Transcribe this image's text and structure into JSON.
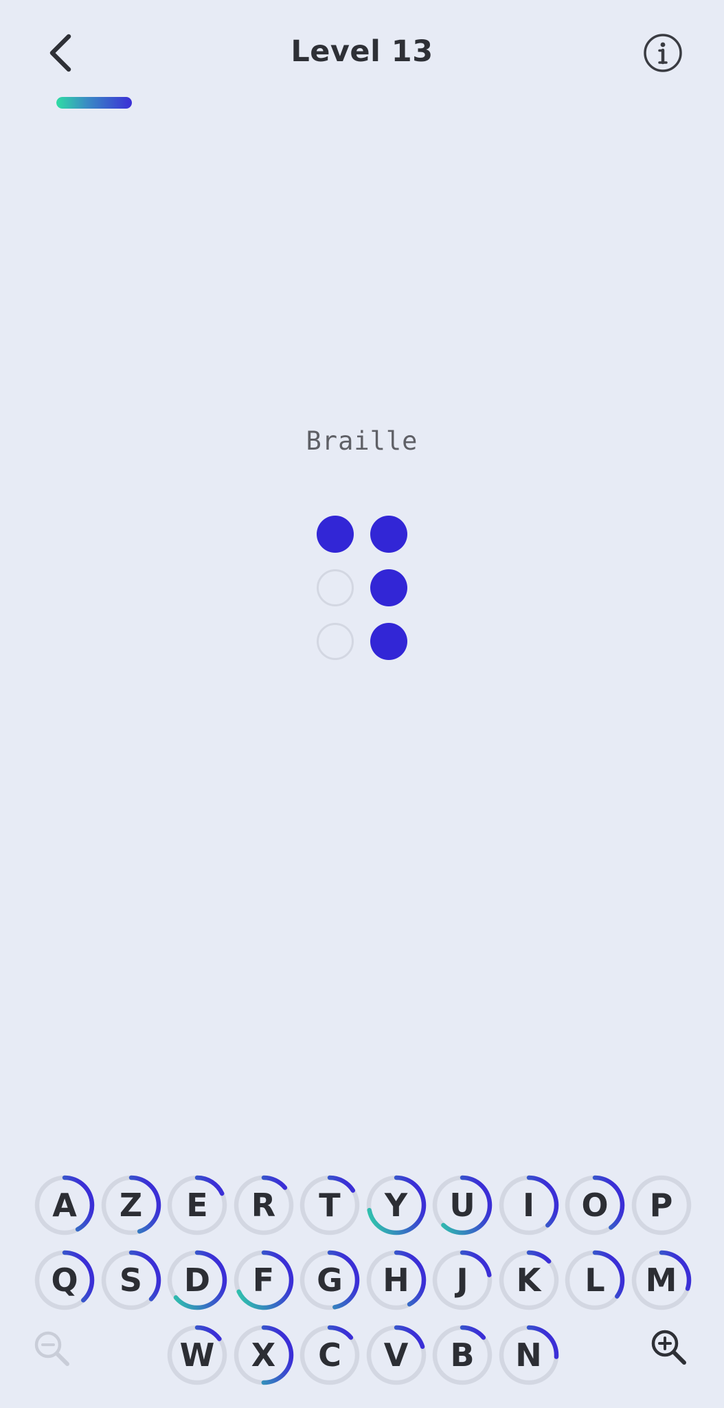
{
  "header": {
    "title": "Level 13",
    "back_icon": "chevron-left-icon",
    "info_icon": "info-icon"
  },
  "progress": {
    "fraction": 0.33
  },
  "cipher": {
    "label": "Braille",
    "dots": [
      true,
      false,
      false,
      true,
      true,
      true
    ]
  },
  "colors": {
    "background": "#e7ebf5",
    "dot_filled": "#3226d6",
    "dot_empty_border": "#d3d7e2",
    "ring_track": "#d3d7e2",
    "ring_start": "#2fd3a8",
    "ring_end": "#3b2fd6"
  },
  "keyboard": {
    "rows": [
      [
        {
          "letter": "A",
          "progress": 0.42
        },
        {
          "letter": "Z",
          "progress": 0.45
        },
        {
          "letter": "E",
          "progress": 0.18
        },
        {
          "letter": "R",
          "progress": 0.14
        },
        {
          "letter": "T",
          "progress": 0.16
        },
        {
          "letter": "Y",
          "progress": 0.72
        },
        {
          "letter": "U",
          "progress": 0.62
        },
        {
          "letter": "I",
          "progress": 0.38
        },
        {
          "letter": "O",
          "progress": 0.4
        },
        {
          "letter": "P",
          "progress": 0.0
        }
      ],
      [
        {
          "letter": "Q",
          "progress": 0.38
        },
        {
          "letter": "S",
          "progress": 0.37
        },
        {
          "letter": "D",
          "progress": 0.64
        },
        {
          "letter": "F",
          "progress": 0.68
        },
        {
          "letter": "G",
          "progress": 0.47
        },
        {
          "letter": "H",
          "progress": 0.42
        },
        {
          "letter": "J",
          "progress": 0.22
        },
        {
          "letter": "K",
          "progress": 0.13
        },
        {
          "letter": "L",
          "progress": 0.35
        },
        {
          "letter": "M",
          "progress": 0.3
        }
      ],
      [
        {
          "letter": "W",
          "progress": 0.15
        },
        {
          "letter": "X",
          "progress": 0.5
        },
        {
          "letter": "C",
          "progress": 0.14
        },
        {
          "letter": "V",
          "progress": 0.2
        },
        {
          "letter": "B",
          "progress": 0.14
        },
        {
          "letter": "N",
          "progress": 0.26
        }
      ]
    ],
    "zoom_out_icon": "zoom-out-icon",
    "zoom_in_icon": "zoom-in-icon"
  }
}
